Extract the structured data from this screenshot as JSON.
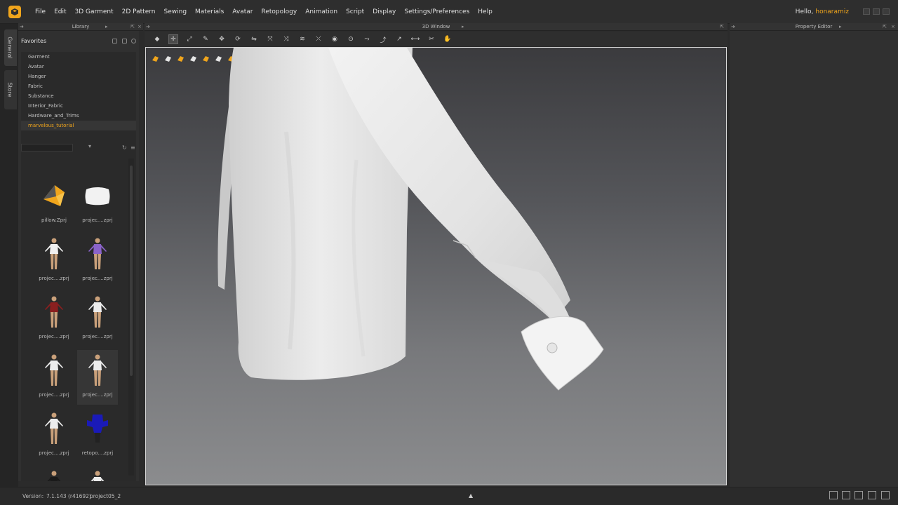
{
  "menubar": {
    "items": [
      "File",
      "Edit",
      "3D Garment",
      "2D Pattern",
      "Sewing",
      "Materials",
      "Avatar",
      "Retopology",
      "Animation",
      "Script",
      "Display",
      "Settings/Preferences",
      "Help"
    ],
    "greeting": "Hello,",
    "username": "honaramiz"
  },
  "side_tabs": [
    "General",
    "Store"
  ],
  "panels": {
    "library_title": "Library",
    "window3d_title": "3D Window",
    "property_title": "Property Editor"
  },
  "library": {
    "favorites_title": "Favorites",
    "favorites": [
      "Garment",
      "Avatar",
      "Hanger",
      "Fabric",
      "Substance",
      "Interior_Fabric",
      "Hardware_and_Trims",
      "marvelous_tutorial"
    ],
    "active_favorite": "marvelous_tutorial",
    "files": [
      {
        "name": "pillow.Zprj",
        "icon": "pillow-colored-icon"
      },
      {
        "name": "projec....zprj",
        "icon": "pillow-white-icon"
      },
      {
        "name": "projec....zprj",
        "icon": "avatar-white-shirt-icon"
      },
      {
        "name": "projec....zprj",
        "icon": "avatar-purple-icon"
      },
      {
        "name": "projec....zprj",
        "icon": "avatar-red-icon"
      },
      {
        "name": "projec....zprj",
        "icon": "avatar-white-icon"
      },
      {
        "name": "projec....zprj",
        "icon": "avatar-white-icon"
      },
      {
        "name": "projec....zprj",
        "icon": "avatar-white-icon"
      },
      {
        "name": "projec....zprj",
        "icon": "avatar-white-icon"
      },
      {
        "name": "retopo....zprj",
        "icon": "retopo-blue-icon"
      },
      {
        "name": "",
        "icon": "avatar-black-icon"
      },
      {
        "name": "",
        "icon": "avatar-white-icon"
      }
    ]
  },
  "status": {
    "version_label": "Version:",
    "version": "7.1.143 (r41692)",
    "project": "project05_2"
  },
  "colors": {
    "accent": "#f0a51c",
    "background": "#2b2b2b"
  }
}
